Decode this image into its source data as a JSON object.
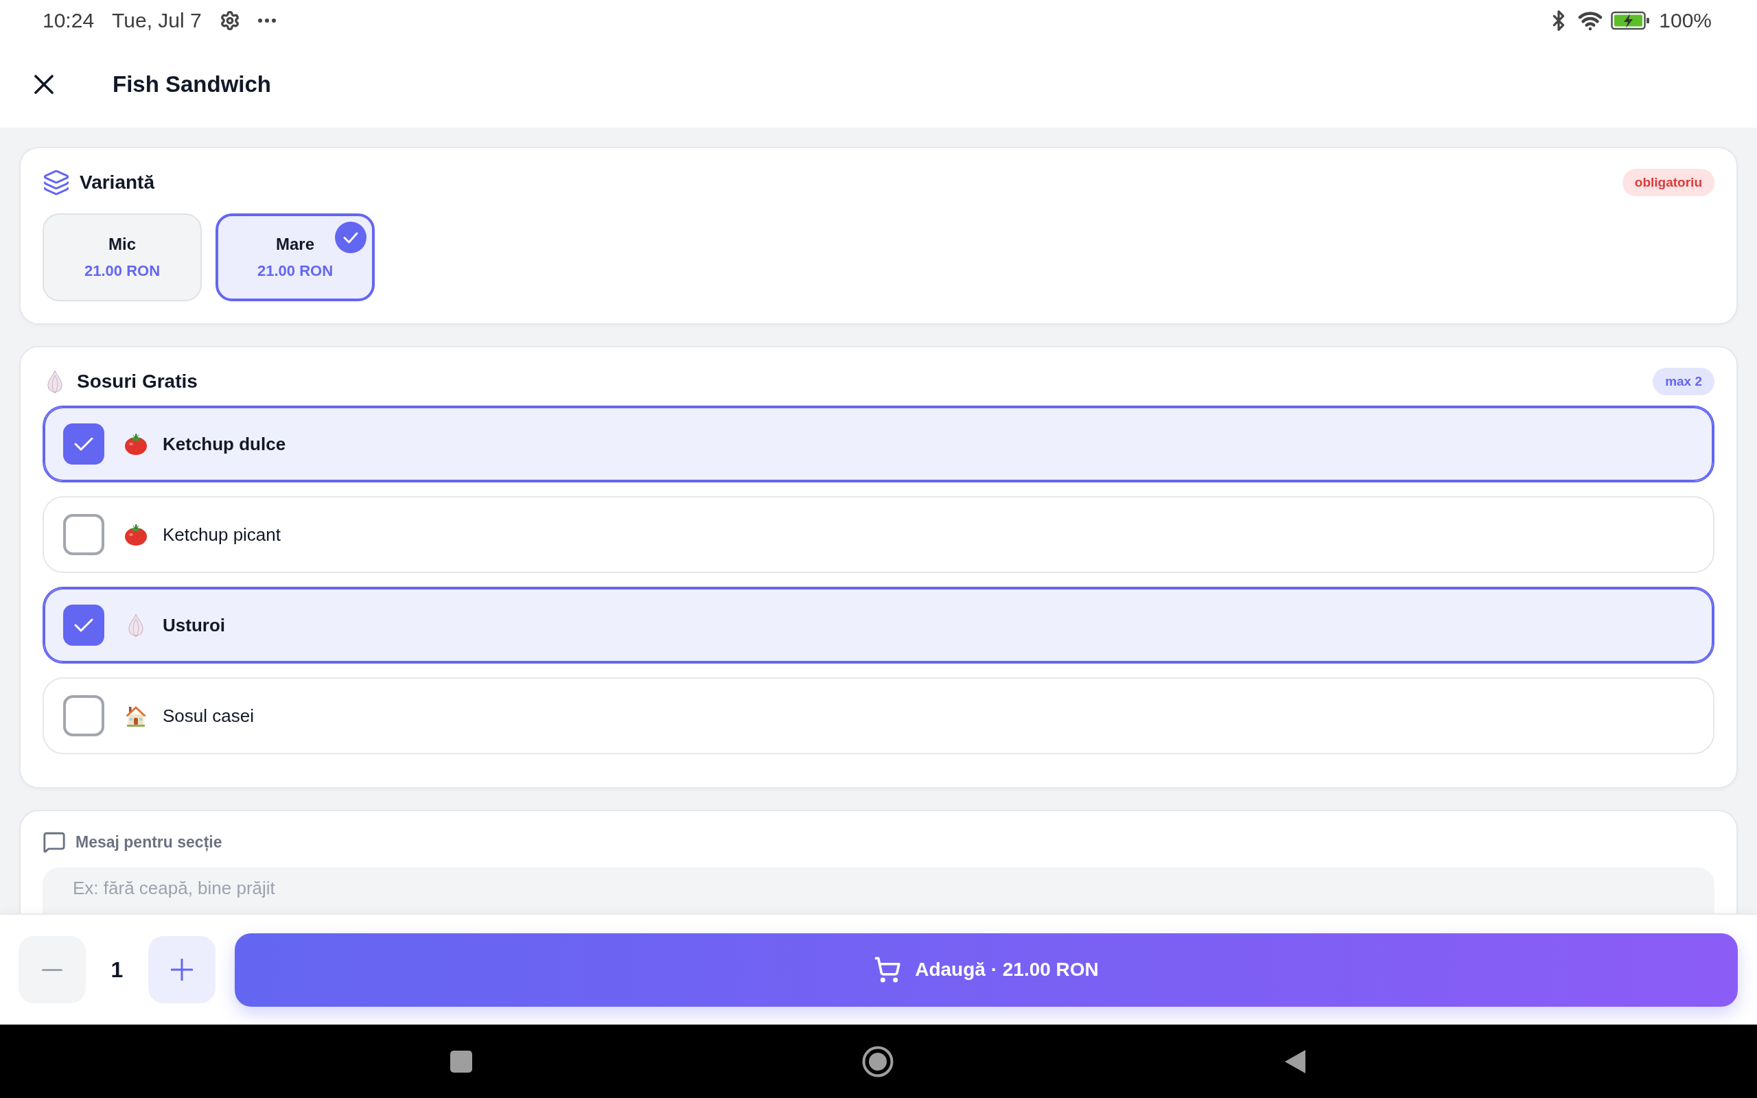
{
  "status_bar": {
    "time": "10:24",
    "date": "Tue, Jul 7",
    "battery": "100%"
  },
  "header": {
    "title": "Fish Sandwich"
  },
  "variant_section": {
    "title": "Variantă",
    "badge": "obligatoriu",
    "options": [
      {
        "name": "Mic",
        "price": "21.00 RON",
        "selected": false
      },
      {
        "name": "Mare",
        "price": "21.00 RON",
        "selected": true
      }
    ]
  },
  "sauces_section": {
    "title": "Sosuri Gratis",
    "badge": "max 2",
    "items": [
      {
        "kind": "tomato",
        "label": "Ketchup dulce",
        "checked": true
      },
      {
        "kind": "tomato",
        "label": "Ketchup picant",
        "checked": false
      },
      {
        "kind": "garlic",
        "label": "Usturoi",
        "checked": true
      },
      {
        "kind": "house",
        "label": "Sosul casei",
        "checked": false
      }
    ]
  },
  "message_section": {
    "title": "Mesaj pentru secție",
    "placeholder": "Ex: fără ceapă, bine prăjit"
  },
  "footer": {
    "quantity": "1",
    "add_button": "Adaugă · 21.00 RON"
  }
}
